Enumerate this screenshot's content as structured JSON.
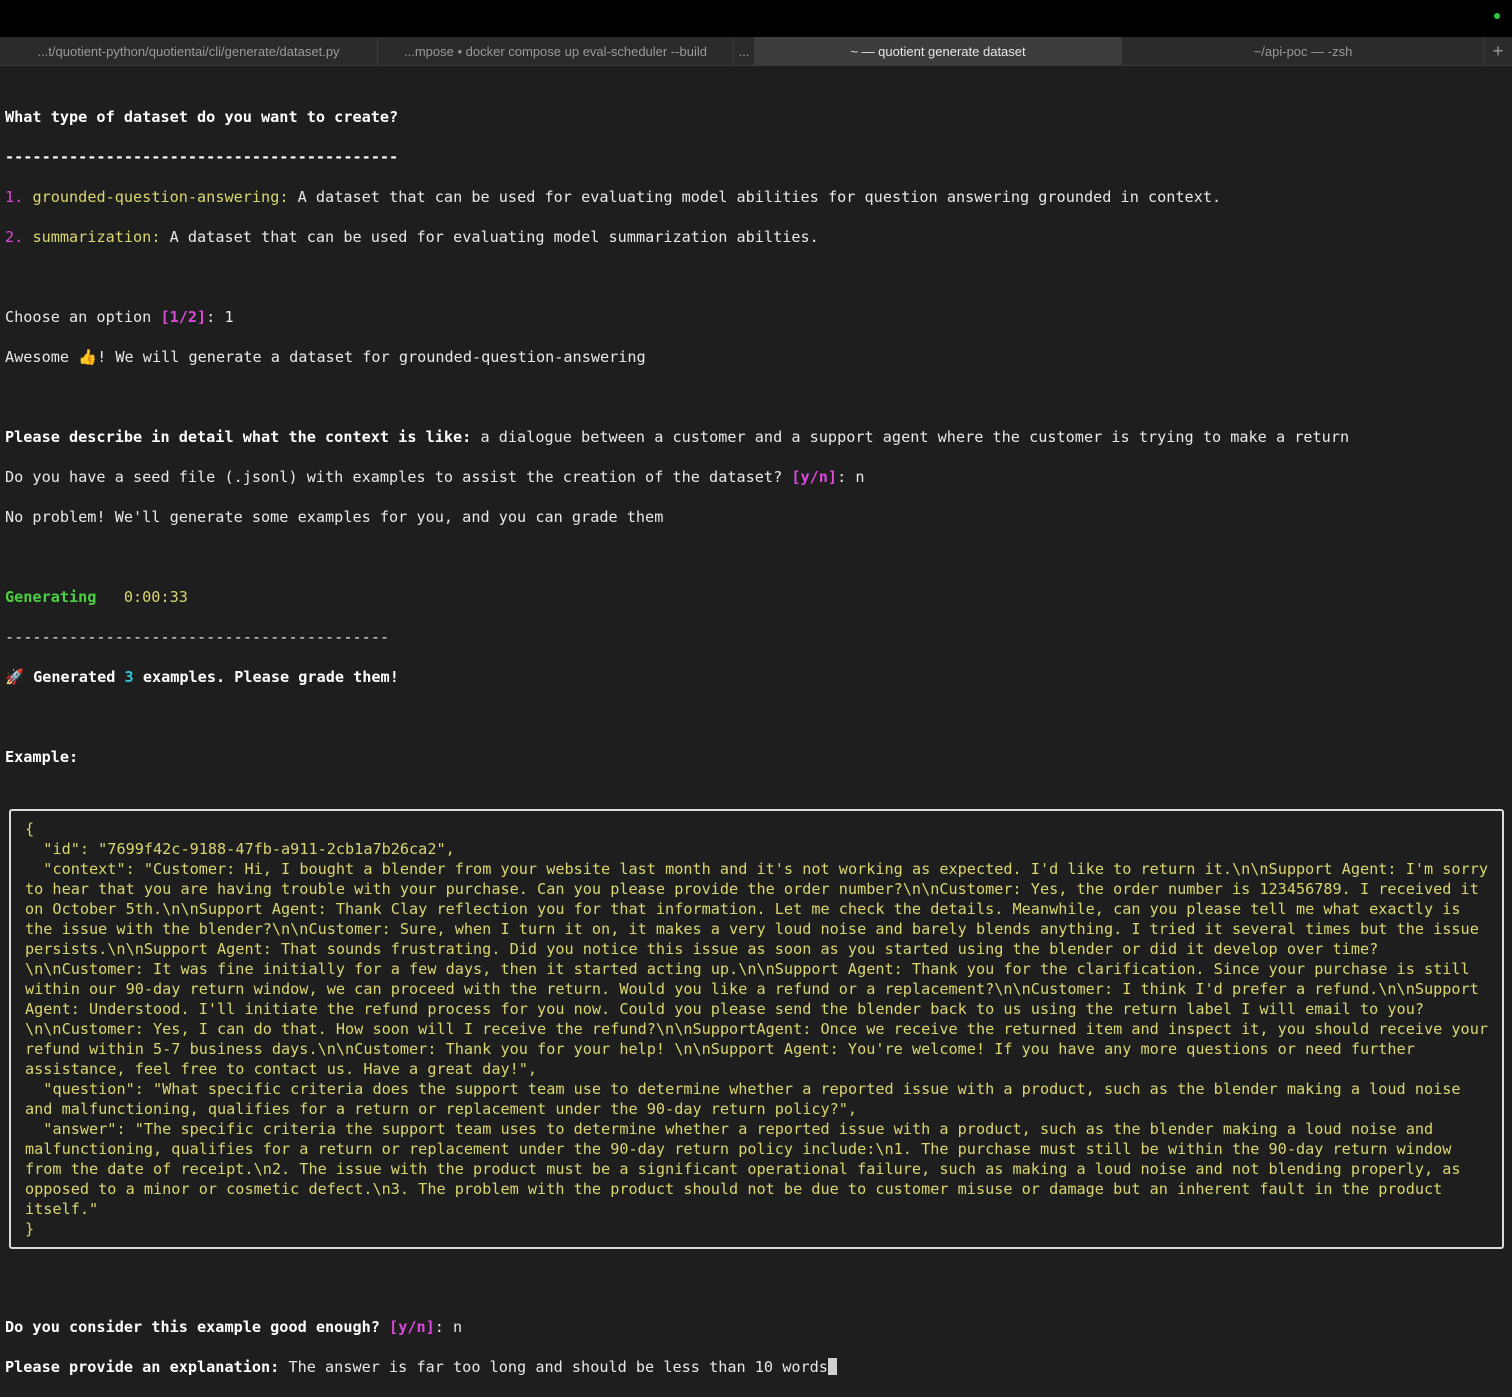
{
  "tabs": [
    {
      "label": "...t/quotient-python/quotientai/cli/generate/dataset.py",
      "active": false
    },
    {
      "label": "...mpose • docker compose up eval-scheduler --build",
      "active": false
    },
    {
      "label": "~ — quotient generate dataset",
      "active": true
    },
    {
      "label": "~/api-poc — -zsh",
      "active": false
    }
  ],
  "tab_more": "...",
  "tab_new": "+",
  "terminal": {
    "question": "What type of dataset do you want to create?",
    "rule1": "-------------------------------------------",
    "opt1_num": "1.",
    "opt1_name": "grounded-question-answering:",
    "opt1_desc": " A dataset that can be used for evaluating model abilities for question answering grounded in context.",
    "opt2_num": "2.",
    "opt2_name": "summarization:",
    "opt2_desc": " A dataset that can be used for evaluating model summarization abilties.",
    "choose_prefix": "Choose an option ",
    "choose_choices": "[1/2]",
    "choose_suffix": ": 1",
    "awesome_prefix": "Awesome ",
    "awesome_emoji": "👍",
    "awesome_suffix": "! We will generate a dataset for grounded-question-answering",
    "describe_label": "Please describe in detail what the context is like:",
    "describe_value": " a dialogue between a customer and a support agent where the customer is trying to make a return",
    "seed_prefix": "Do you have a seed file (.jsonl) with examples to assist the creation of the dataset? ",
    "seed_choices": "[y/n]",
    "seed_suffix": ": n",
    "no_problem": "No problem! We'll generate some examples for you, and you can grade them",
    "generating_label": "Generating",
    "generating_time": "   0:00:33",
    "rule2": "------------------------------------------",
    "generated_emoji": "🚀",
    "generated_prefix": " Generated ",
    "generated_count": "3",
    "generated_suffix": " examples. Please grade them!",
    "example_label": "Example:",
    "example_json": "{\n  \"id\": \"7699f42c-9188-47fb-a911-2cb1a7b26ca2\",\n  \"context\": \"Customer: Hi, I bought a blender from your website last month and it's not working as expected. I'd like to return it.\\n\\nSupport Agent: I'm sorry to hear that you are having trouble with your purchase. Can you please provide the order number?\\n\\nCustomer: Yes, the order number is 123456789. I received it on October 5th.\\n\\nSupport Agent: Thank Clay reflection you for that information. Let me check the details. Meanwhile, can you please tell me what exactly is the issue with the blender?\\n\\nCustomer: Sure, when I turn it on, it makes a very loud noise and barely blends anything. I tried it several times but the issue persists.\\n\\nSupport Agent: That sounds frustrating. Did you notice this issue as soon as you started using the blender or did it develop over time?\\n\\nCustomer: It was fine initially for a few days, then it started acting up.\\n\\nSupport Agent: Thank you for the clarification. Since your purchase is still within our 90-day return window, we can proceed with the return. Would you like a refund or a replacement?\\n\\nCustomer: I think I'd prefer a refund.\\n\\nSupport Agent: Understood. I'll initiate the refund process for you now. Could you please send the blender back to us using the return label I will email to you?\\n\\nCustomer: Yes, I can do that. How soon will I receive the refund?\\n\\nSupportAgent: Once we receive the returned item and inspect it, you should receive your refund within 5-7 business days.\\n\\nCustomer: Thank you for your help! \\n\\nSupport Agent: You're welcome! If you have any more questions or need further assistance, feel free to contact us. Have a great day!\",\n  \"question\": \"What specific criteria does the support team use to determine whether a reported issue with a product, such as the blender making a loud noise and malfunctioning, qualifies for a return or replacement under the 90-day return policy?\",\n  \"answer\": \"The specific criteria the support team uses to determine whether a reported issue with a product, such as the blender making a loud noise and malfunctioning, qualifies for a return or replacement under the 90-day return policy include:\\n1. The purchase must still be within the 90-day return window from the date of receipt.\\n2. The issue with the product must be a significant operational failure, such as making a loud noise and not blending properly, as opposed to a minor or cosmetic defect.\\n3. The problem with the product should not be due to customer misuse or damage but an inherent fault in the product itself.\"\n}",
    "good_prefix": "Do you consider this example good enough? ",
    "good_choices": "[y/n]",
    "good_suffix": ": n",
    "explain_label": "Please provide an explanation:",
    "explain_value": " The answer is far too long and should be less than 10 words"
  },
  "colors": {
    "background": "#1e1e1e",
    "magenta": "#d94ad8",
    "yellow": "#dbd66f",
    "green": "#4ad13f",
    "cyan": "#36c3d9"
  },
  "icons": {
    "status": "green-status-dot",
    "new_tab": "plus-icon",
    "thumbs_up": "thumbs-up-emoji",
    "rocket": "rocket-emoji"
  }
}
